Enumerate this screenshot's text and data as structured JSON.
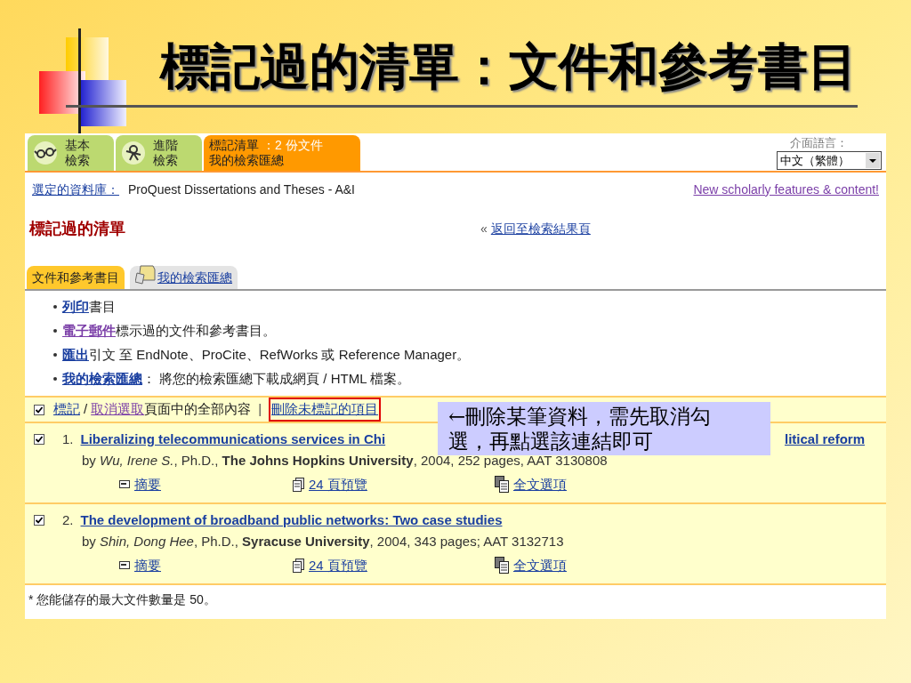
{
  "slide_title": "標記過的清單：文件和參考書目",
  "nav_tabs": [
    {
      "lines": [
        "基本",
        "檢索"
      ],
      "selected": false
    },
    {
      "lines": [
        "進階",
        "檢索"
      ],
      "selected": false
    },
    {
      "lines": [
        "標記清單",
        "：2 份文件",
        "我的檢索匯總"
      ],
      "selected": true
    }
  ],
  "language": {
    "label": "介面語言：",
    "value": "中文（繁體）"
  },
  "database": {
    "label": "選定的資料庫：",
    "value": "ProQuest Dissertations and Theses - A&I"
  },
  "promo_link": {
    "text": "New scholarly features & content!",
    "visited": true
  },
  "heading": "標記過的清單",
  "back_link": {
    "prefix": "«",
    "text": "返回至檢索結果頁"
  },
  "sub_tabs": [
    {
      "label": "文件和參考書目",
      "selected": true
    },
    {
      "label": "我的檢索匯總",
      "selected": false
    }
  ],
  "actions": [
    {
      "link": "列印",
      "text": "書目",
      "visited": false
    },
    {
      "link": "電子郵件",
      "text": "標示過的文件和參考書目。",
      "visited": true
    },
    {
      "link": "匯出",
      "text": "引文 至 EndNote、ProCite、RefWorks 或 Reference Manager。",
      "visited": false
    },
    {
      "link": "我的檢索匯總",
      "text": "： 將您的檢索匯總下載成網頁 / HTML 檔案。",
      "visited": false
    }
  ],
  "select_bar": {
    "checked": true,
    "mark": "標記",
    "separator": "/",
    "unselect": "取消選取",
    "text": "頁面中的全部內容",
    "divider": "|",
    "delete": "刪除未標記的項目",
    "highlighted": true
  },
  "callout": {
    "lines": [
      "←刪除某筆資料，需先取消勾",
      "選，再點選該連結即可"
    ]
  },
  "records": [
    {
      "checked": true,
      "number": "1.",
      "title_parts": [
        "Liberalizing telecommunications services in Chi",
        "litical reform"
      ],
      "byline": "by *Wu, Irene S.*, Ph.D., **The Johns Hopkins University**, 2004, 252 pages, AAT 3130808",
      "links": [
        {
          "kind": "abstract",
          "text": "摘要"
        },
        {
          "kind": "preview",
          "text": "24 頁預覽"
        },
        {
          "kind": "fulltext",
          "text": "全文選項"
        }
      ]
    },
    {
      "checked": true,
      "number": "2.",
      "title_parts": [
        "The development of broadband public networks: Two case studies"
      ],
      "byline": "by *Shin, Dong Hee*, Ph.D., **Syracuse University**, 2004, 343 pages; AAT 3132713",
      "links": [
        {
          "kind": "abstract",
          "text": "摘要"
        },
        {
          "kind": "preview",
          "text": "24 頁預覽"
        },
        {
          "kind": "fulltext",
          "text": "全文選項"
        }
      ]
    }
  ],
  "footnote": "* 您能儲存的最大文件數量是 50。"
}
